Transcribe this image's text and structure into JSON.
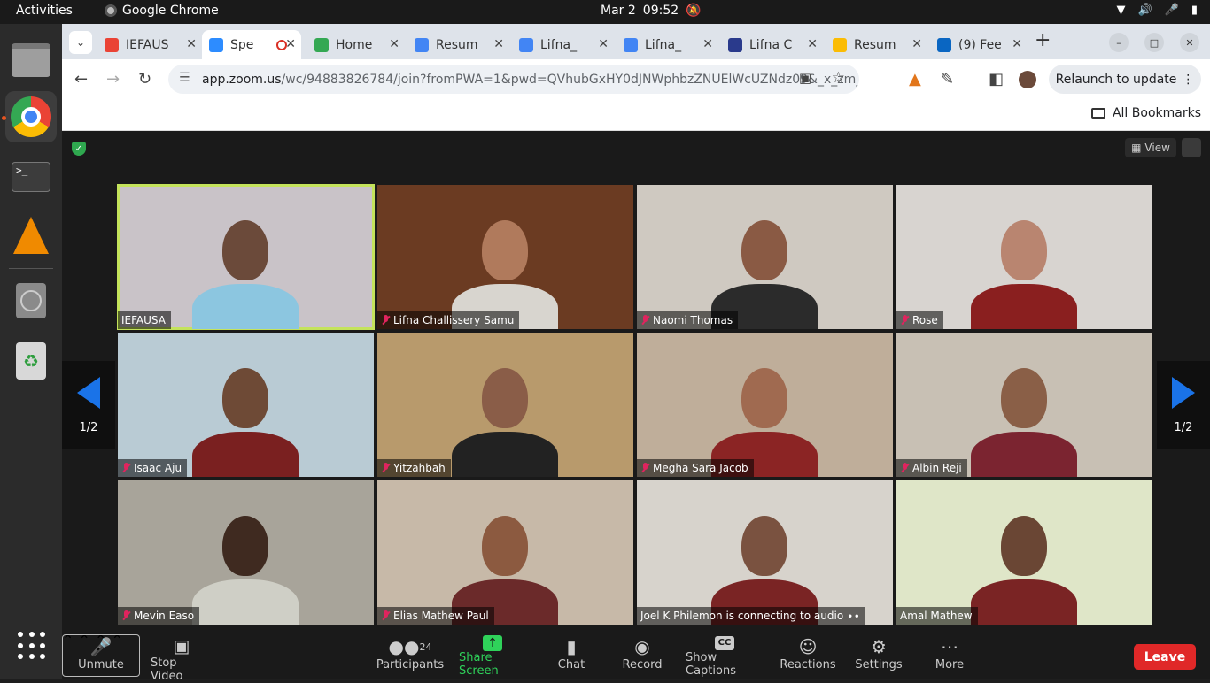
{
  "topbar": {
    "activities": "Activities",
    "app_name": "Google Chrome",
    "date": "Mar 2",
    "time": "09:52"
  },
  "browser": {
    "tabs": [
      {
        "title": "IEFAUS",
        "favicon_color": "#ea4335",
        "icon": "gmail-icon"
      },
      {
        "title": "Spe",
        "favicon_color": "#2d8cff",
        "icon": "zoom-icon",
        "active": true
      },
      {
        "title": "Home",
        "favicon_color": "#34a853",
        "icon": "drive-icon"
      },
      {
        "title": "Resum",
        "favicon_color": "#4285f4",
        "icon": "docs-icon"
      },
      {
        "title": "Lifna_",
        "favicon_color": "#4285f4",
        "icon": "docs-icon"
      },
      {
        "title": "Lifna_",
        "favicon_color": "#4285f4",
        "icon": "docs-icon"
      },
      {
        "title": "Lifna C",
        "favicon_color": "#2a3a8c",
        "icon": "forms-icon"
      },
      {
        "title": "Resum",
        "favicon_color": "#fbbc04",
        "icon": "slides-icon"
      },
      {
        "title": "(9) Fee",
        "favicon_color": "#0a66c2",
        "icon": "linkedin-icon"
      }
    ],
    "url_host": "app.zoom.us",
    "url_path": "/wc/94883826784/join?fromPWA=1&pwd=QVhubGxHY0dJNWphbzZNUElWcUZNdz09&_x_zm_rta...",
    "relaunch_label": "Relaunch to update",
    "bookmarks_label": "All Bookmarks"
  },
  "zoom": {
    "view_label": "View",
    "page_indicator": "1/2",
    "participants": [
      {
        "name": "IEFAUSA",
        "muted": false,
        "speaking": true,
        "bg": "#c9c3c8",
        "skin": "#6b4a3a",
        "shirt": "#8cc6e0"
      },
      {
        "name": "Lifna Challissery Samu",
        "muted": true,
        "speaking": false,
        "bg": "#6b3b22",
        "skin": "#b07a5c",
        "shirt": "#d8d5cf"
      },
      {
        "name": "Naomi Thomas",
        "muted": true,
        "speaking": false,
        "bg": "#cfc9c1",
        "skin": "#8a5a44",
        "shirt": "#2b2b2b"
      },
      {
        "name": "Rose",
        "muted": true,
        "speaking": false,
        "bg": "#d8d4d0",
        "skin": "#b98570",
        "shirt": "#8a1f1f"
      },
      {
        "name": "Isaac Aju",
        "muted": true,
        "speaking": false,
        "bg": "#b9cbd4",
        "skin": "#6e4a36",
        "shirt": "#7a2020"
      },
      {
        "name": "Yitzahbah",
        "muted": true,
        "speaking": false,
        "bg": "#b89a6c",
        "skin": "#8a5d48",
        "shirt": "#222222"
      },
      {
        "name": "Megha Sara Jacob",
        "muted": true,
        "speaking": false,
        "bg": "#bfae9a",
        "skin": "#a06a50",
        "shirt": "#8b2424"
      },
      {
        "name": "Albin Reji",
        "muted": true,
        "speaking": false,
        "bg": "#c8c0b4",
        "skin": "#8a5f47",
        "shirt": "#7b2430"
      },
      {
        "name": "Mevin Easo",
        "muted": true,
        "speaking": false,
        "bg": "#a8a49a",
        "skin": "#3f2a20",
        "shirt": "#cfcfc6"
      },
      {
        "name": "Elias Mathew Paul",
        "muted": true,
        "speaking": false,
        "bg": "#c7b9a8",
        "skin": "#8c5a40",
        "shirt": "#6b2a2a"
      },
      {
        "name": "Joel K Philemon is connecting to audio ∙∙",
        "muted": false,
        "speaking": false,
        "bg": "#d7d3cc",
        "skin": "#7a5240",
        "shirt": "#7a2424"
      },
      {
        "name": "Amal Mathew",
        "muted": false,
        "speaking": false,
        "bg": "#dfe6c8",
        "skin": "#6a4634",
        "shirt": "#7a2424"
      }
    ]
  },
  "controls": {
    "unmute": "Unmute",
    "stop_video": "Stop Video",
    "participants": "Participants",
    "participant_count": "24",
    "share_screen": "Share Screen",
    "chat": "Chat",
    "record": "Record",
    "show_captions": "Show Captions",
    "reactions": "Reactions",
    "settings": "Settings",
    "more": "More",
    "leave": "Leave"
  }
}
